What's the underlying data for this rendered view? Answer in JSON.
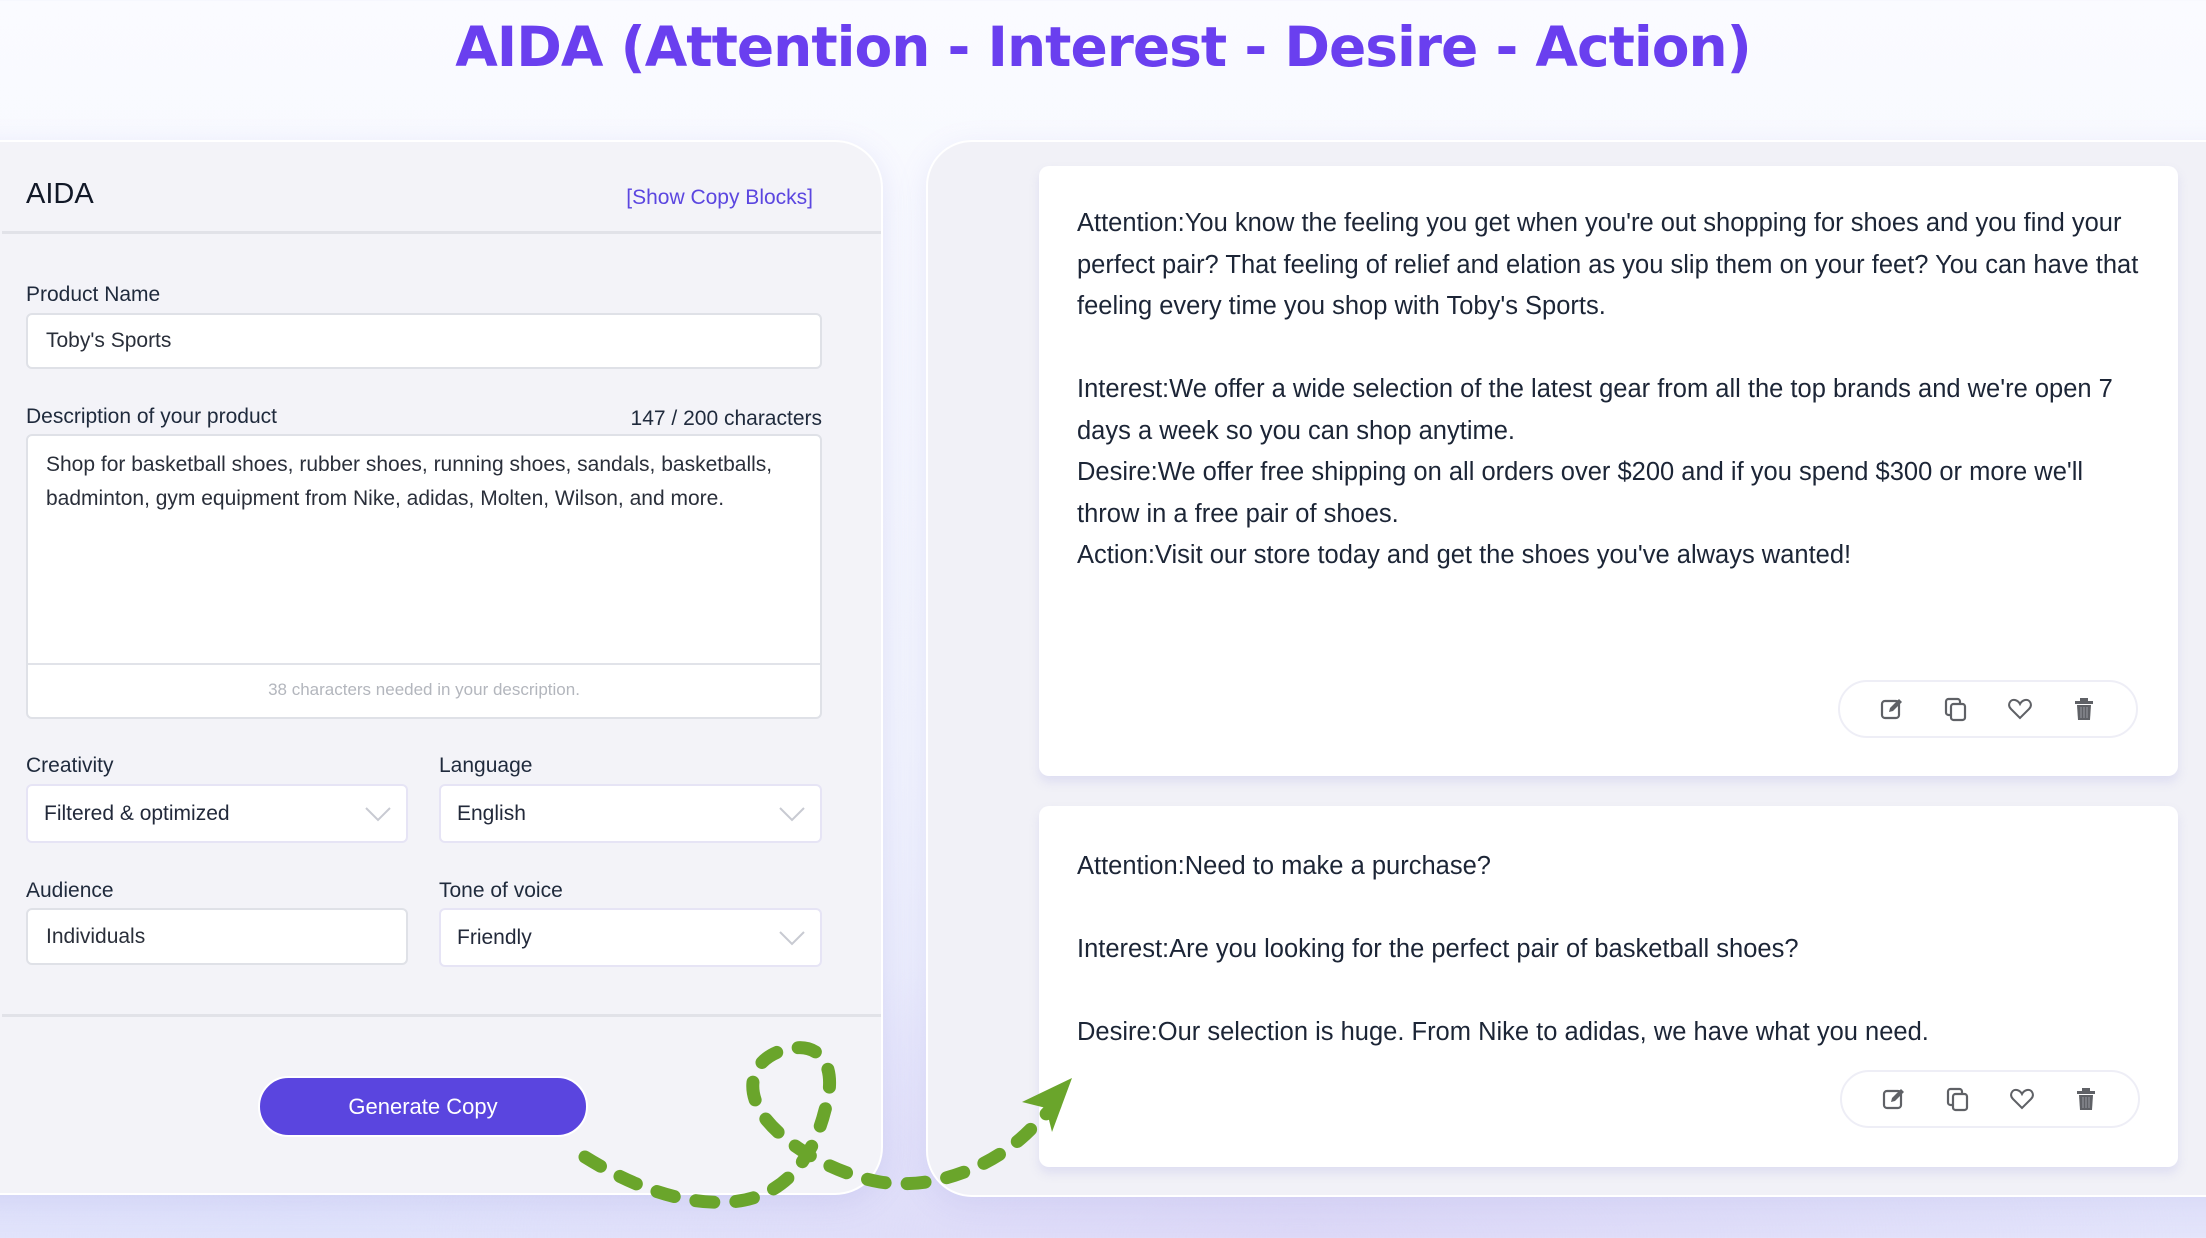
{
  "page_title": "AIDA (Attention - Interest - Desire - Action)",
  "form": {
    "title": "AIDA",
    "show_copy_blocks": "[Show Copy Blocks]",
    "product_name": {
      "label": "Product Name",
      "value": "Toby's Sports"
    },
    "description": {
      "label": "Description of your product",
      "char_count": "147 / 200 characters",
      "value": "Shop for basketball shoes, rubber shoes, running shoes, sandals, basketballs, badminton, gym equipment from Nike, adidas, Molten, Wilson, and more.",
      "hint": "38 characters needed in your description."
    },
    "creativity": {
      "label": "Creativity",
      "value": "Filtered & optimized"
    },
    "language": {
      "label": "Language",
      "value": "English"
    },
    "audience": {
      "label": "Audience",
      "value": "Individuals"
    },
    "tone": {
      "label": "Tone of voice",
      "value": "Friendly"
    },
    "generate_label": "Generate Copy"
  },
  "results": [
    {
      "paragraphs": [
        "Attention:You know the feeling you get when you're out shopping for shoes and you find your perfect pair? That feeling of relief and elation as you slip them on your feet? You can have that feeling every time you shop with Toby's Sports.",
        "Interest:We offer a wide selection of the latest gear from all the top brands and we're open 7 days a week so you can shop anytime.",
        "Desire:We offer free shipping on all orders over $200 and if you spend $300 or more we'll throw in a free pair of shoes.",
        "Action:Visit our store today and get the shoes you've always wanted!"
      ],
      "actions": [
        "edit-icon",
        "copy-icon",
        "heart-icon",
        "trash-icon"
      ]
    },
    {
      "paragraphs": [
        "Attention:Need to make a purchase?",
        "Interest:Are you looking for the perfect pair of basketball shoes?",
        "Desire:Our selection is huge. From Nike to adidas, we have what you need."
      ],
      "actions": [
        "edit-icon",
        "copy-icon",
        "heart-icon",
        "trash-icon"
      ]
    }
  ],
  "colors": {
    "accent": "#5a45df",
    "title": "#6a3fef",
    "arrow": "#6aa52b",
    "link": "#5b46e0"
  }
}
